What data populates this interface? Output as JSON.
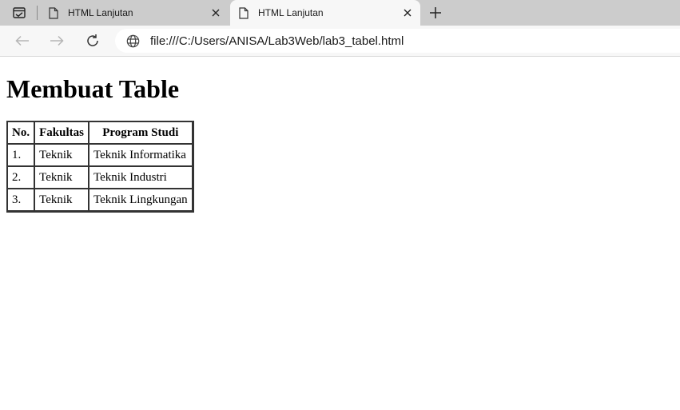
{
  "browser": {
    "tabs": [
      {
        "title": "HTML Lanjutan",
        "active": false
      },
      {
        "title": "HTML Lanjutan",
        "active": true
      }
    ],
    "address": "file:///C:/Users/ANISA/Lab3Web/lab3_tabel.html"
  },
  "icons": {
    "tab_actions": "tab-actions-icon",
    "doc": "document-icon",
    "close": "close-icon",
    "new_tab": "plus-icon",
    "back": "arrow-left-icon",
    "forward": "arrow-right-icon",
    "refresh": "refresh-icon",
    "globe": "globe-icon"
  },
  "page": {
    "heading": "Membuat Table",
    "table": {
      "headers": [
        "No.",
        "Fakultas",
        "Program Studi"
      ],
      "rows": [
        [
          "1.",
          "Teknik",
          "Teknik Informatika"
        ],
        [
          "2.",
          "Teknik",
          "Teknik Industri"
        ],
        [
          "3.",
          "Teknik",
          "Teknik Lingkungan"
        ]
      ]
    }
  }
}
